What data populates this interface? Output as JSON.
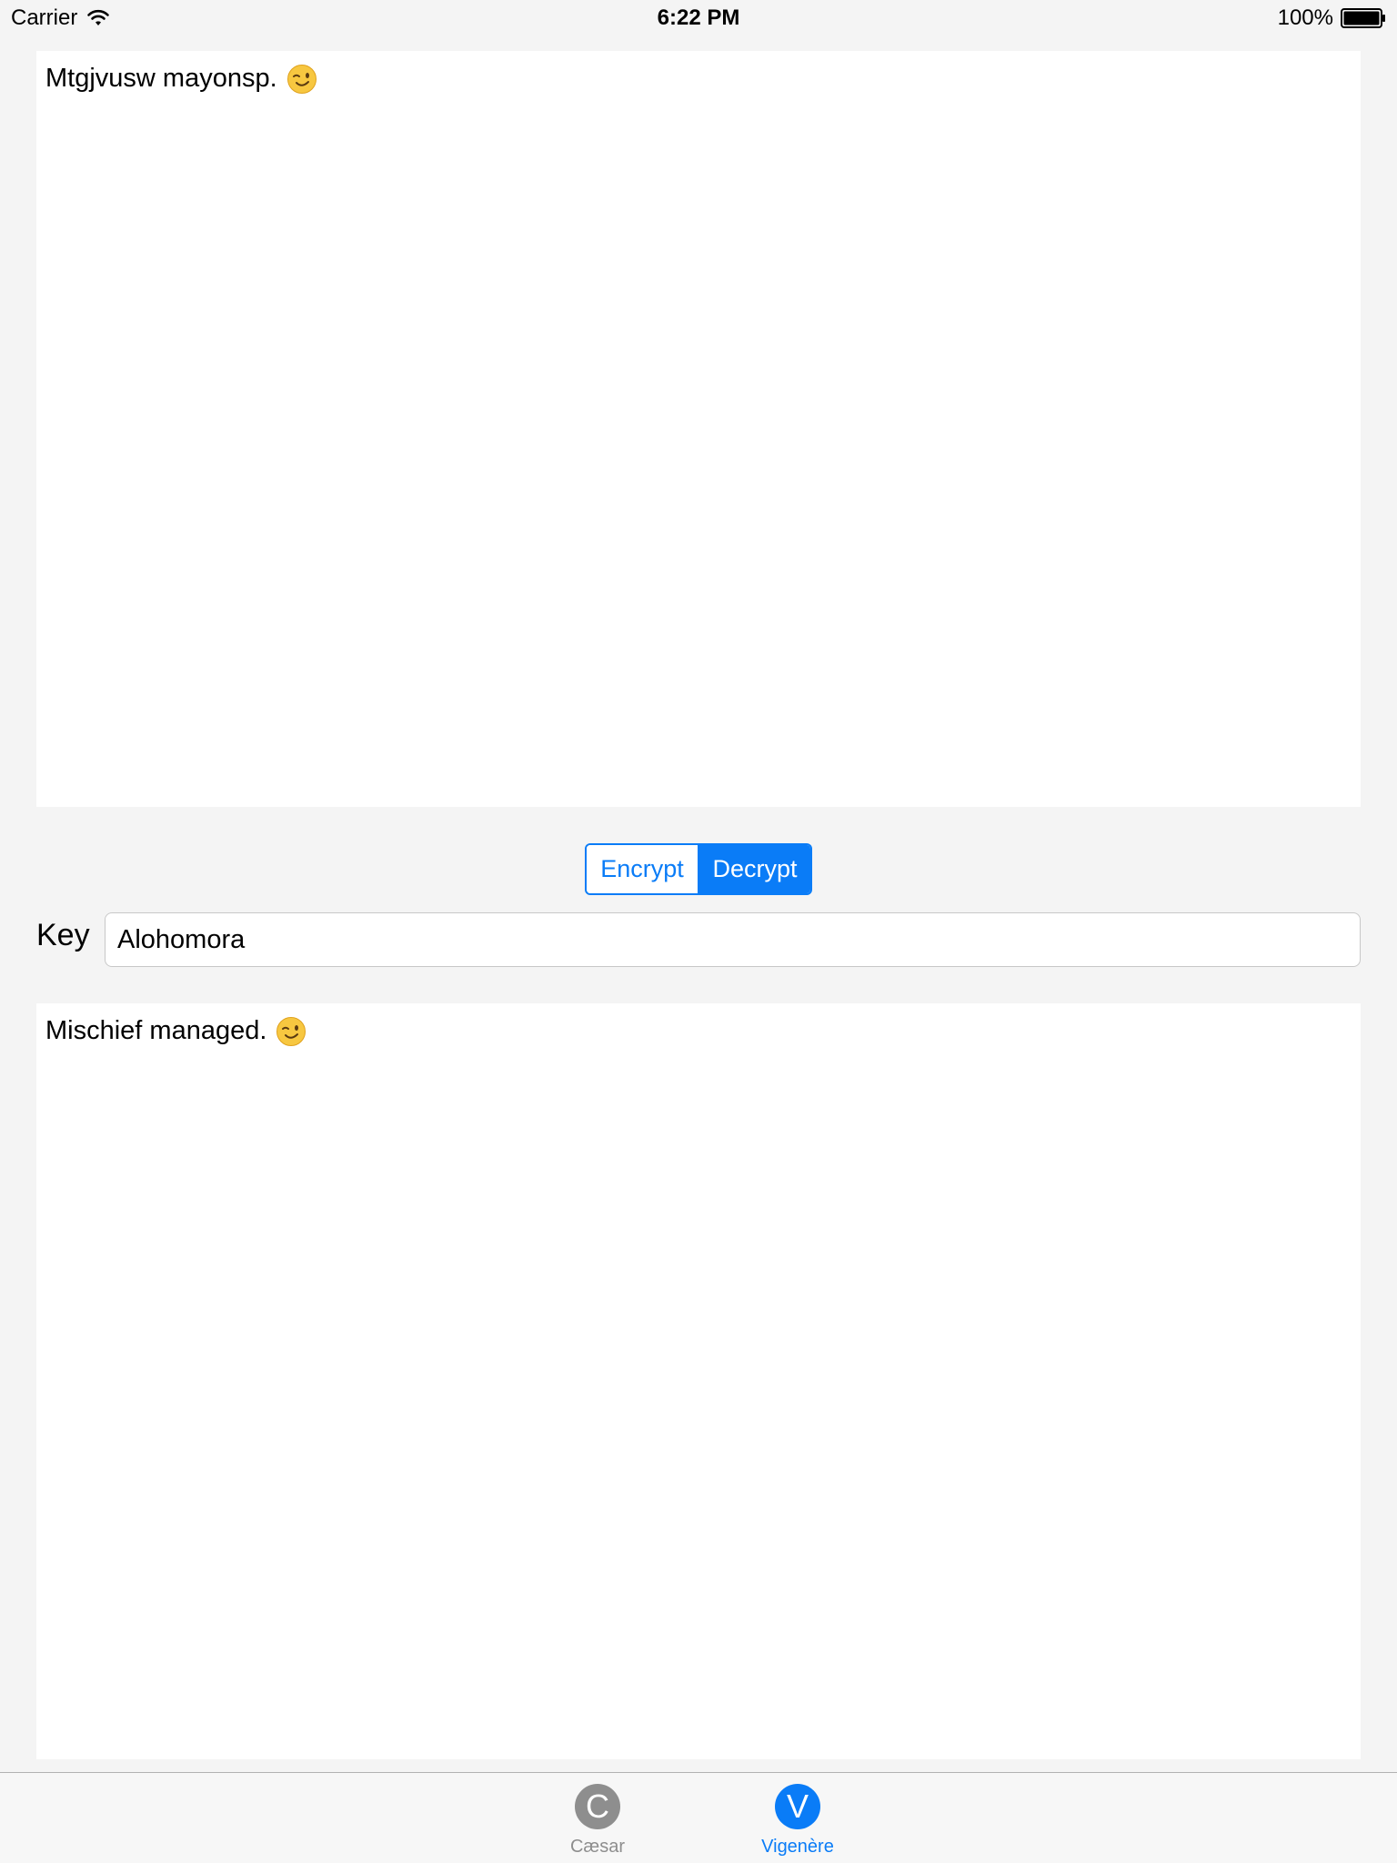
{
  "status_bar": {
    "carrier": "Carrier",
    "time": "6:22 PM",
    "battery": "100%"
  },
  "input_text": {
    "value": "Mtgjvusw mayonsp.",
    "emoji": "winking-face"
  },
  "mode_control": {
    "encrypt_label": "Encrypt",
    "decrypt_label": "Decrypt",
    "selected": "Decrypt"
  },
  "key": {
    "label": "Key",
    "value": "Alohomora"
  },
  "output_text": {
    "value": "Mischief managed.",
    "emoji": "winking-face"
  },
  "tabs": [
    {
      "icon_letter": "C",
      "label": "Cæsar",
      "selected": false
    },
    {
      "icon_letter": "V",
      "label": "Vigenère",
      "selected": true
    }
  ],
  "colors": {
    "accent": "#0a7cf7",
    "background": "#f4f4f4",
    "inactive_tab": "#8e8e8e"
  }
}
